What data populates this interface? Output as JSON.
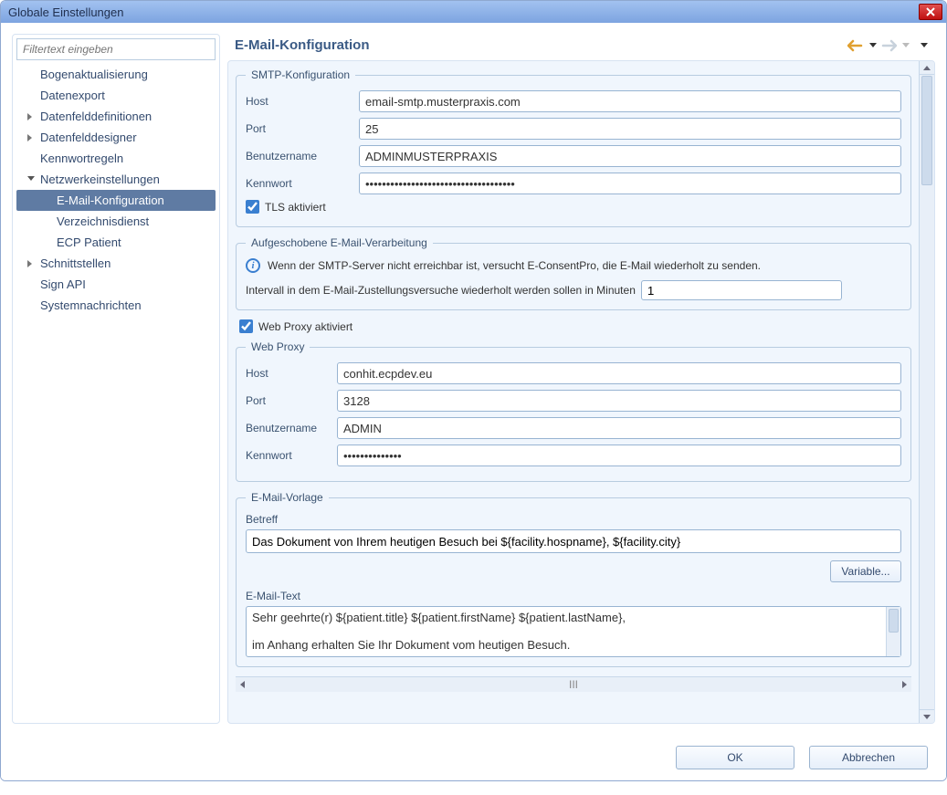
{
  "window": {
    "title": "Globale Einstellungen"
  },
  "sidebar": {
    "filter_placeholder": "Filtertext eingeben",
    "items": [
      {
        "label": "Bogenaktualisierung",
        "level": "top"
      },
      {
        "label": "Datenexport",
        "level": "top"
      },
      {
        "label": "Datenfelddefinitionen",
        "level": "group",
        "expanded": false
      },
      {
        "label": "Datenfelddesigner",
        "level": "group",
        "expanded": false
      },
      {
        "label": "Kennwortregeln",
        "level": "top"
      },
      {
        "label": "Netzwerkeinstellungen",
        "level": "group",
        "expanded": true
      },
      {
        "label": "E-Mail-Konfiguration",
        "level": "child",
        "selected": true
      },
      {
        "label": "Verzeichnisdienst",
        "level": "child"
      },
      {
        "label": "ECP Patient",
        "level": "child"
      },
      {
        "label": "Schnittstellen",
        "level": "group",
        "expanded": false
      },
      {
        "label": "Sign API",
        "level": "top"
      },
      {
        "label": "Systemnachrichten",
        "level": "top"
      }
    ]
  },
  "content": {
    "title": "E-Mail-Konfiguration",
    "smtp": {
      "legend": "SMTP-Konfiguration",
      "host_label": "Host",
      "host_value": "email-smtp.musterpraxis.com",
      "port_label": "Port",
      "port_value": "25",
      "user_label": "Benutzername",
      "user_value": "ADMINMUSTERPRAXIS",
      "pass_label": "Kennwort",
      "pass_value": "••••••••••••••••••••••••••••••••••••",
      "tls_label": "TLS aktiviert",
      "tls_checked": true
    },
    "deferred": {
      "legend": "Aufgeschobene E-Mail-Verarbeitung",
      "info_text": "Wenn der SMTP-Server nicht erreichbar ist, versucht E-ConsentPro, die E-Mail wiederholt zu senden.",
      "interval_label": "Intervall in dem E-Mail-Zustellungsversuche wiederholt werden sollen in Minuten",
      "interval_value": "1"
    },
    "proxy_checkbox_label": "Web Proxy aktiviert",
    "proxy_checked": true,
    "proxy": {
      "legend": "Web Proxy",
      "host_label": "Host",
      "host_value": "conhit.ecpdev.eu",
      "port_label": "Port",
      "port_value": "3128",
      "user_label": "Benutzername",
      "user_value": "ADMIN",
      "pass_label": "Kennwort",
      "pass_value": "••••••••••••••"
    },
    "template": {
      "legend": "E-Mail-Vorlage",
      "subject_label": "Betreff",
      "subject_value": "Das Dokument von Ihrem heutigen Besuch bei ${facility.hospname}, ${facility.city}",
      "variable_button": "Variable...",
      "body_label": "E-Mail-Text",
      "body_value": "Sehr geehrte(r) ${patient.title} ${patient.firstName} ${patient.lastName},\n\nim Anhang erhalten Sie Ihr Dokument vom heutigen Besuch."
    }
  },
  "footer": {
    "ok": "OK",
    "cancel": "Abbrechen"
  }
}
